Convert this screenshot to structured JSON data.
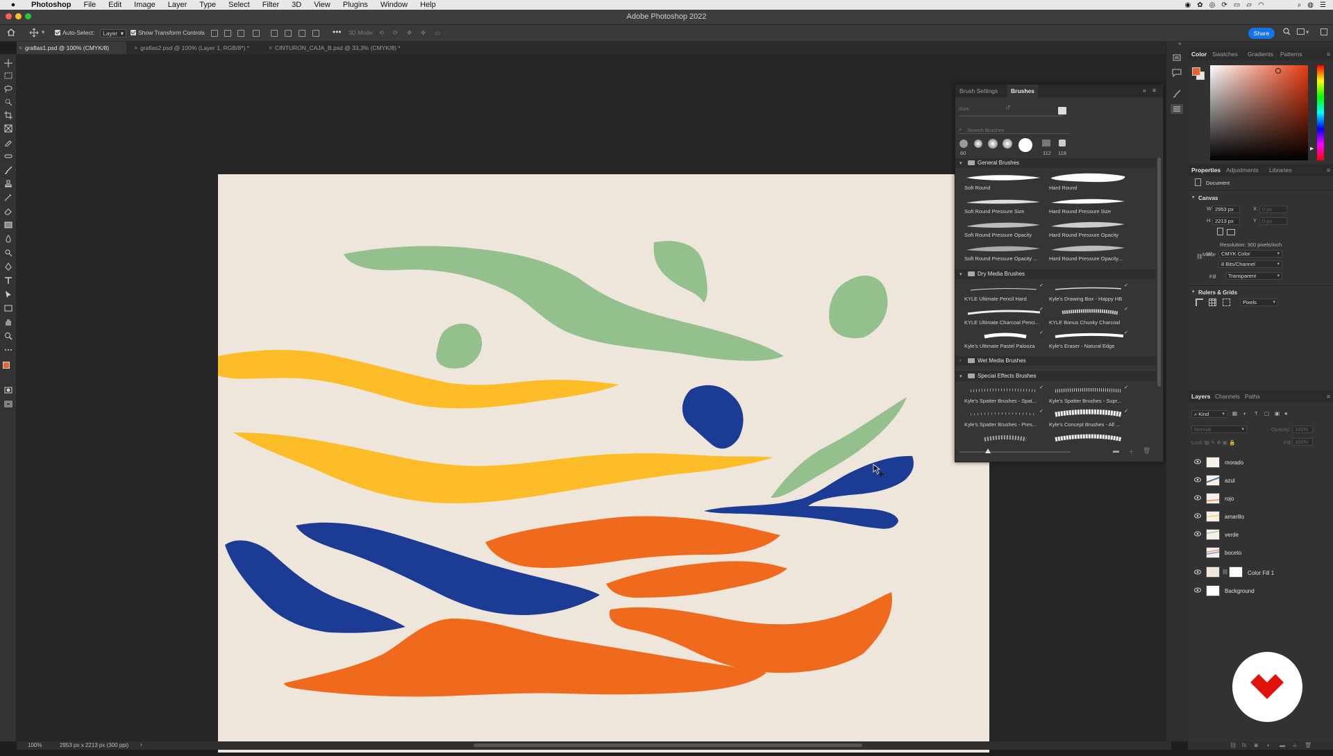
{
  "menubar": {
    "app": "Photoshop",
    "items": [
      "File",
      "Edit",
      "Image",
      "Layer",
      "Type",
      "Select",
      "Filter",
      "3D",
      "View",
      "Plugins",
      "Window",
      "Help"
    ]
  },
  "window": {
    "title": "Adobe Photoshop 2022"
  },
  "options": {
    "auto_select_label": "Auto-Select:",
    "auto_select_value": "Layer",
    "transform_label": "Show Transform Controls",
    "mode_3d": "3D Mode:",
    "share": "Share"
  },
  "tabs": [
    {
      "label": "grafias1.psd @ 100% (CMYK/8)",
      "active": true
    },
    {
      "label": "grafias2.psd @ 100% (Layer 1, RGB/8*) *",
      "active": false
    },
    {
      "label": "CINTURON_CAJA_B.psd @ 33,3% (CMYK/8) *",
      "active": false
    }
  ],
  "status": {
    "zoom": "100%",
    "info": "2953 px x 2213 px (300 ppi)"
  },
  "brushes_panel": {
    "tabs": [
      "Brush Settings",
      "Brushes"
    ],
    "size_label": "Size:",
    "search_placeholder": "Search Brushes",
    "recent_sizes": [
      "60",
      "112",
      "118"
    ],
    "categories": [
      {
        "name": "General Brushes",
        "brushes": [
          "Soft Round",
          "Hard Round",
          "Soft Round Pressure Size",
          "Hard Round Pressure Size",
          "Soft Round Pressure Opacity",
          "Hard Round Pressure Opacity",
          "Soft Round Pressure Opacity ...",
          "Hard Round Pressure Opacity..."
        ]
      },
      {
        "name": "Dry Media Brushes",
        "brushes": [
          "KYLE Ultimate Pencil Hard",
          "Kyle's Drawing Box - Happy HB",
          "KYLE Ultimate Charcoal Penci...",
          "KYLE Bonus Chunky Charcoal",
          "Kyle's Ultimate Pastel Palooza",
          "Kyle's Eraser - Natural Edge"
        ]
      },
      {
        "name": "Wet Media Brushes",
        "brushes": []
      },
      {
        "name": "Special Effects Brushes",
        "brushes": [
          "Kyle's Spatter Brushes - Spat...",
          "Kyle's Spatter Brushes - Supr...",
          "Kyle's Spatter Brushes - Pres...",
          "Kyle's Concept Brushes - All ..."
        ]
      }
    ]
  },
  "color_panel": {
    "tabs": [
      "Color",
      "Swatches",
      "Gradients",
      "Patterns"
    ],
    "foreground": "#e8642c"
  },
  "properties": {
    "tabs": [
      "Properties",
      "Adjustments",
      "Libraries"
    ],
    "kind": "Document",
    "canvas_label": "Canvas",
    "w_label": "W",
    "w_value": "2953 px",
    "h_label": "H",
    "h_value": "2213 px",
    "x_label": "X",
    "x_value": "0 px",
    "y_label": "Y",
    "y_value": "0 px",
    "resolution": "Resolution: 300 pixels/inch",
    "mode_label": "Mode",
    "mode_value": "CMYK Color",
    "bits_value": "8 Bits/Channel",
    "fill_label": "Fill",
    "fill_value": "Transparent",
    "rulers_label": "Rulers & Grids",
    "units_value": "Pixels"
  },
  "layers_panel": {
    "tabs": [
      "Layers",
      "Channels",
      "Paths"
    ],
    "kind_filter": "Kind",
    "blend": "Normal",
    "opacity_label": "Opacity:",
    "opacity_value": "100%",
    "lock_label": "Lock:",
    "fill_label": "Fill:",
    "fill_value": "100%",
    "layers": [
      {
        "name": "morado",
        "visible": true
      },
      {
        "name": "azul",
        "visible": true
      },
      {
        "name": "rojo",
        "visible": true
      },
      {
        "name": "amarillo",
        "visible": true
      },
      {
        "name": "verde",
        "visible": true
      },
      {
        "name": "boceto",
        "visible": false
      },
      {
        "name": "Color Fill 1",
        "visible": true
      },
      {
        "name": "Background",
        "visible": true
      }
    ]
  },
  "colors": {
    "green": "#93c08c",
    "yellow": "#fdbd29",
    "blue": "#1c3b94",
    "orange": "#f06a1e",
    "canvas": "#eee6da",
    "accent": "#1473e6",
    "logo_red": "#e0120b"
  }
}
